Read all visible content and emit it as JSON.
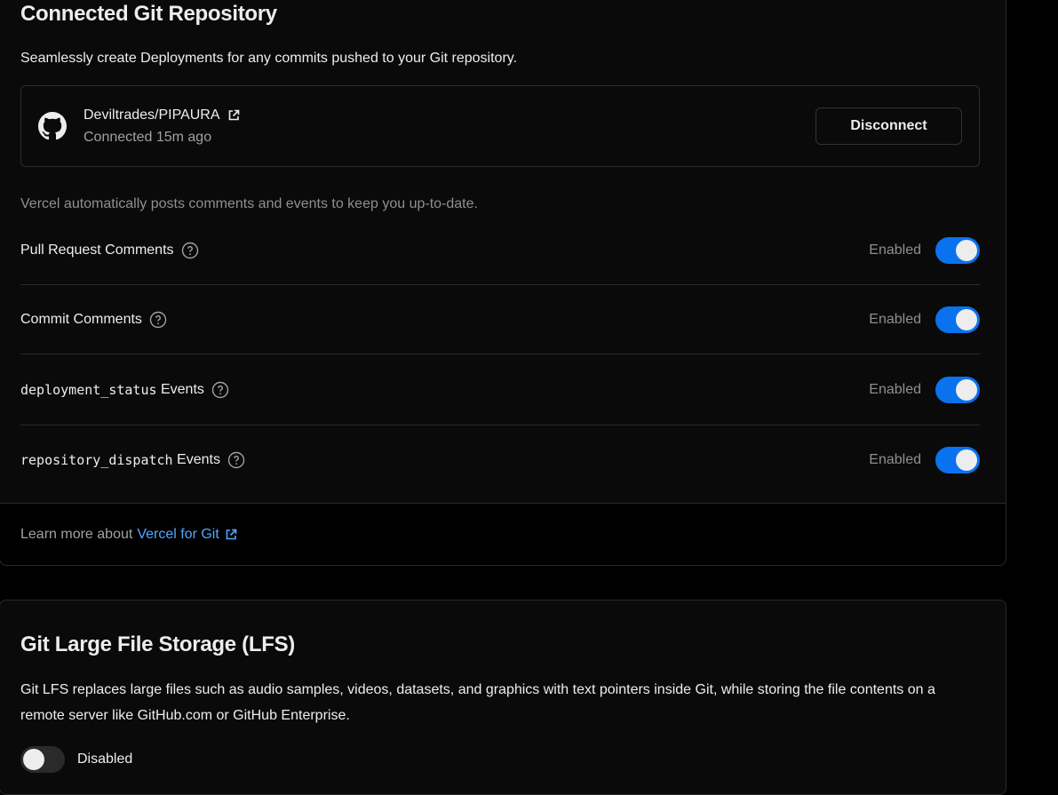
{
  "git_section": {
    "title": "Connected Git Repository",
    "description": "Seamlessly create Deployments for any commits pushed to your Git repository.",
    "repo": {
      "name": "Deviltrades/PIPAURA",
      "connected": "Connected 15m ago",
      "disconnect_label": "Disconnect"
    },
    "note": "Vercel automatically posts comments and events to keep you up-to-date.",
    "settings": [
      {
        "label": "Pull Request Comments",
        "code": "",
        "suffix": "",
        "status": "Enabled"
      },
      {
        "label": "",
        "code": "",
        "suffix": "Commit Comments",
        "status": "Enabled"
      },
      {
        "label": "",
        "code": "deployment_status",
        "suffix": " Events",
        "status": "Enabled"
      },
      {
        "label": "",
        "code": "repository_dispatch",
        "suffix": " Events",
        "status": "Enabled"
      }
    ],
    "footer": {
      "prefix": "Learn more about",
      "link": "Vercel for Git"
    }
  },
  "lfs_section": {
    "title": "Git Large File Storage (LFS)",
    "description": "Git LFS replaces large files such as audio samples, videos, datasets, and graphics with text pointers inside Git, while storing the file contents on a remote server like GitHub.com or GitHub Enterprise.",
    "toggle_label": "Disabled"
  },
  "colors": {
    "accent": "#0a72ef",
    "link": "#52a8ff",
    "background": "#000000",
    "card": "#0a0a0a"
  },
  "icons": [
    "github-icon",
    "external-link-icon",
    "help-circle-icon"
  ]
}
